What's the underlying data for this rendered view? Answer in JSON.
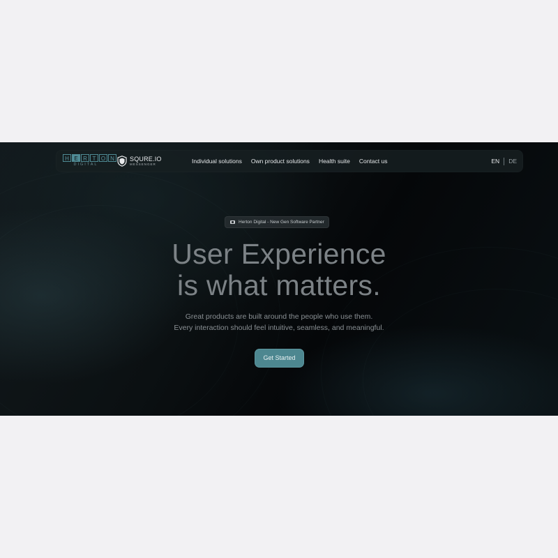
{
  "brand": {
    "herton_letters": [
      "H",
      "E",
      "R",
      "T",
      "O",
      "N"
    ],
    "herton_sub": "DIGITAL",
    "squre_name": "SQURE.IO",
    "squre_sub": "MESSENGER"
  },
  "nav": {
    "links": [
      "Individual solutions",
      "Own product solutions",
      "Health suite",
      "Contact us"
    ]
  },
  "lang": {
    "active": "EN",
    "other": "DE"
  },
  "hero": {
    "badge": "Herton Digital - New Gen Software Partner",
    "headline_line1": "User Experience",
    "headline_line2": "is what matters.",
    "subtext_line1": "Great products are built around the people who use them.",
    "subtext_line2": "Every interaction should feel intuitive, seamless, and meaningful.",
    "cta_label": "Get Started"
  },
  "colors": {
    "page_bg": "#f2f1f3",
    "hero_bg": "#0b1012",
    "accent": "#4d8790",
    "headline": "#7c8286"
  },
  "icons": {
    "badge_icon": "card-icon",
    "squre_icon": "shield-icon"
  }
}
